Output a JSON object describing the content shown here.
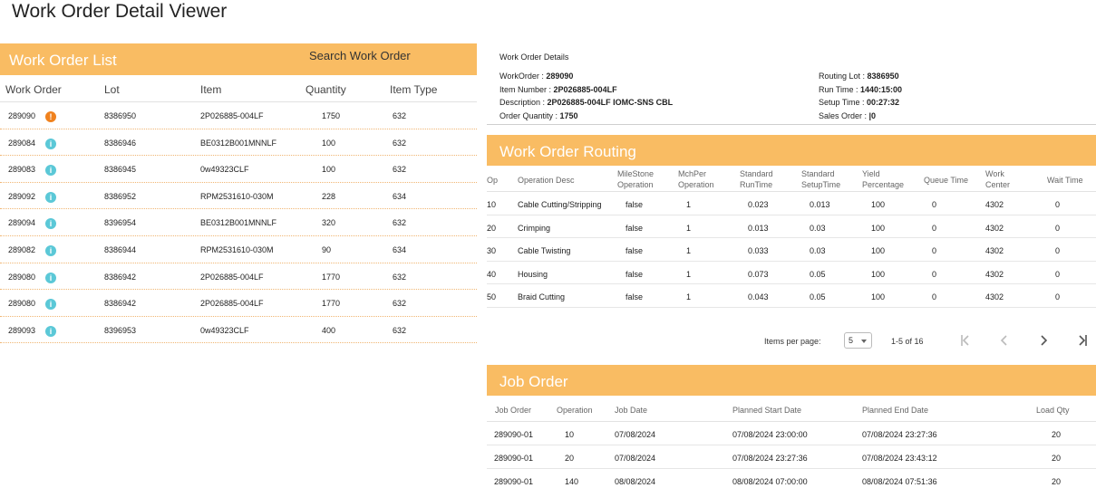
{
  "app": {
    "title": "Work Order Detail Viewer"
  },
  "colors": {
    "accent": "#f9bc63",
    "warn": "#f0821e",
    "info": "#5bc8d7"
  },
  "left": {
    "title": "Work Order List",
    "search_label": "Search Work Order",
    "columns": [
      "Work Order",
      "Lot",
      "Item",
      "Quantity",
      "Item Type"
    ],
    "rows": [
      {
        "wo": "289090",
        "icon": "warn",
        "lot": "8386950",
        "item": "2P026885-004LF",
        "qty": "1750",
        "type": "632"
      },
      {
        "wo": "289084",
        "icon": "info",
        "lot": "8386946",
        "item": "BE0312B001MNNLF",
        "qty": "100",
        "type": "632"
      },
      {
        "wo": "289083",
        "icon": "info",
        "lot": "8386945",
        "item": "0w49323CLF",
        "qty": "100",
        "type": "632"
      },
      {
        "wo": "289092",
        "icon": "info",
        "lot": "8386952",
        "item": "RPM2531610-030M",
        "qty": "228",
        "type": "634"
      },
      {
        "wo": "289094",
        "icon": "info",
        "lot": "8396954",
        "item": "BE0312B001MNNLF",
        "qty": "320",
        "type": "632"
      },
      {
        "wo": "289082",
        "icon": "info",
        "lot": "8386944",
        "item": "RPM2531610-030M",
        "qty": "90",
        "type": "634"
      },
      {
        "wo": "289080",
        "icon": "info",
        "lot": "8386942",
        "item": "2P026885-004LF",
        "qty": "1770",
        "type": "632"
      },
      {
        "wo": "289080",
        "icon": "info",
        "lot": "8386942",
        "item": "2P026885-004LF",
        "qty": "1770",
        "type": "632"
      },
      {
        "wo": "289093",
        "icon": "info",
        "lot": "8396953",
        "item": "0w49323CLF",
        "qty": "400",
        "type": "632"
      }
    ]
  },
  "details": {
    "title": "Work Order Details",
    "left_fields": [
      {
        "label": "WorkOrder : ",
        "value": "289090"
      },
      {
        "label": "Item Number : ",
        "value": "2P026885-004LF"
      },
      {
        "label": "Description : ",
        "value": "2P026885-004LF IOMC-SNS CBL"
      },
      {
        "label": "Order Quantity : ",
        "value": "1750"
      }
    ],
    "right_fields": [
      {
        "label": "Routing Lot : ",
        "value": "8386950"
      },
      {
        "label": "Run Time : ",
        "value": "1440:15:00"
      },
      {
        "label": "Setup Time : ",
        "value": "00:27:32"
      },
      {
        "label": "Sales Order : ",
        "value": "|0"
      }
    ]
  },
  "routing": {
    "title": "Work Order Routing",
    "columns": [
      {
        "l1": "Op",
        "l2": ""
      },
      {
        "l1": "Operation Desc",
        "l2": ""
      },
      {
        "l1": "MileStone",
        "l2": "Operation"
      },
      {
        "l1": "MchPer",
        "l2": "Operation"
      },
      {
        "l1": "Standard",
        "l2": "RunTime"
      },
      {
        "l1": "Standard",
        "l2": "SetupTime"
      },
      {
        "l1": "Yield",
        "l2": "Percentage"
      },
      {
        "l1": "Queue Time",
        "l2": ""
      },
      {
        "l1": "Work",
        "l2": "Center"
      },
      {
        "l1": "Wait Time",
        "l2": ""
      }
    ],
    "rows": [
      [
        "10",
        "Cable Cutting/Stripping",
        "false",
        "1",
        "0.023",
        "0.013",
        "100",
        "0",
        "4302",
        "0"
      ],
      [
        "20",
        "Crimping",
        "false",
        "1",
        "0.013",
        "0.03",
        "100",
        "0",
        "4302",
        "0"
      ],
      [
        "30",
        "Cable Twisting",
        "false",
        "1",
        "0.033",
        "0.03",
        "100",
        "0",
        "4302",
        "0"
      ],
      [
        "40",
        "Housing",
        "false",
        "1",
        "0.073",
        "0.05",
        "100",
        "0",
        "4302",
        "0"
      ],
      [
        "50",
        "Braid Cutting",
        "false",
        "1",
        "0.043",
        "0.05",
        "100",
        "0",
        "4302",
        "0"
      ]
    ],
    "paginator": {
      "items_per_page_label": "Items per page:",
      "page_size": "5",
      "range": "1-5 of 16"
    }
  },
  "job": {
    "title": "Job Order",
    "columns": [
      "Job Order",
      "Operation",
      "Job Date",
      "Planned Start Date",
      "Planned End Date",
      "Load Qty"
    ],
    "rows": [
      [
        "289090-01",
        "10",
        "07/08/2024",
        "07/08/2024 23:00:00",
        "07/08/2024 23:27:36",
        "20"
      ],
      [
        "289090-01",
        "20",
        "07/08/2024",
        "07/08/2024 23:27:36",
        "07/08/2024 23:43:12",
        "20"
      ],
      [
        "289090-01",
        "140",
        "08/08/2024",
        "08/08/2024 07:00:00",
        "08/08/2024 07:51:36",
        "20"
      ]
    ]
  }
}
